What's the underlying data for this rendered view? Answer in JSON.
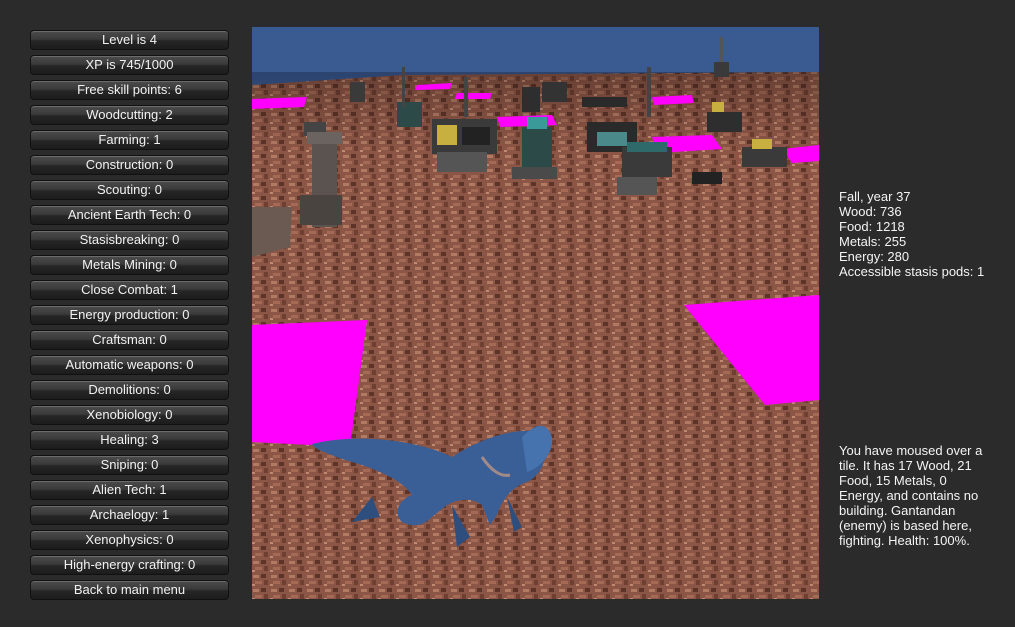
{
  "skills_panel": {
    "buttons": [
      "Level is 4",
      "XP is 745/1000",
      "Free skill points: 6",
      "Woodcutting: 2",
      "Farming: 1",
      "Construction: 0",
      "Scouting: 0",
      "Ancient Earth Tech: 0",
      "Stasisbreaking: 0",
      "Metals Mining: 0",
      "Close Combat: 1",
      "Energy production: 0",
      "Craftsman: 0",
      "Automatic weapons: 0",
      "Demolitions: 0",
      "Xenobiology: 0",
      "Healing: 3",
      "Sniping: 0",
      "Alien Tech: 1",
      "Archaelogy: 1",
      "Xenophysics: 0",
      "High-energy crafting: 0",
      "Back to main menu"
    ]
  },
  "resources": {
    "season": "Fall, year 37",
    "wood": "Wood: 736",
    "food": "Food: 1218",
    "metals": "Metals: 255",
    "energy": "Energy: 280",
    "stasis_pods": "Accessible stasis pods: 1"
  },
  "tile_info": {
    "text": "You have moused over a tile. It has 17 Wood, 21 Food, 15 Metals, 0 Energy, and contains no building. Gantandan (enemy) is based here, fighting. Health: 100%."
  },
  "colors": {
    "background": "#2b2b2b",
    "sky": "#3a5a92",
    "ground": "#8a5544",
    "highlight_tile": "#ff00ff",
    "creature": "#3a5f96"
  }
}
